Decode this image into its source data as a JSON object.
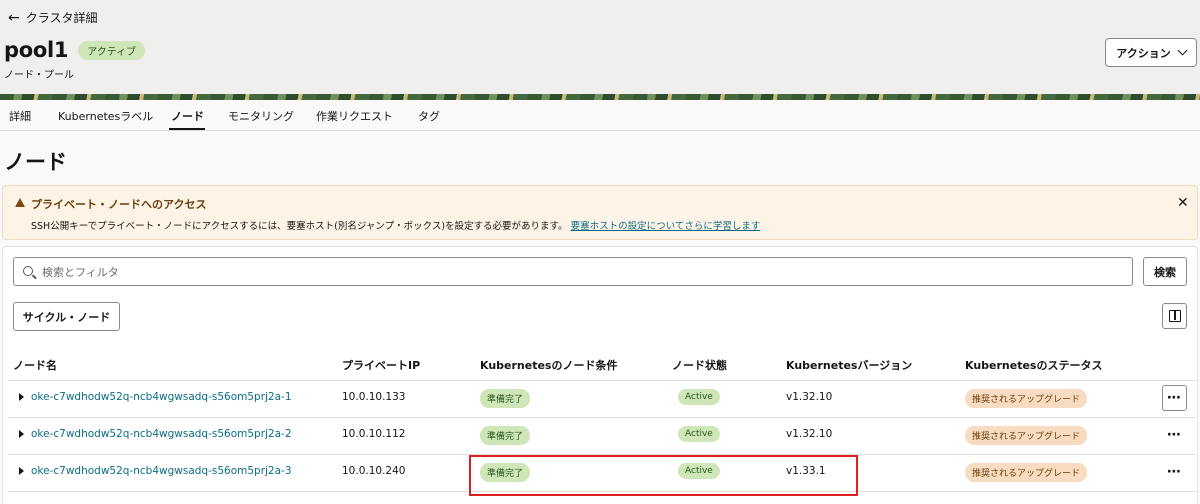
{
  "header": {
    "back_label": "クラスタ詳細",
    "title": "pool1",
    "status": "アクティブ",
    "subtitle": "ノード・プール",
    "action_label": "アクション"
  },
  "tabs": [
    "詳細",
    "Kubernetesラベル",
    "ノード",
    "モニタリング",
    "作業リクエスト",
    "タグ"
  ],
  "active_tab": "ノード",
  "section_title": "ノード",
  "notice": {
    "title": "プライベート・ノードへのアクセス",
    "body": "SSH公開キーでプライベート・ノードにアクセスするには、要塞ホスト(別名ジャンプ・ボックス)を設定する必要があります。",
    "link": "要塞ホストの設定についてさらに学習します",
    "close": "✕"
  },
  "search": {
    "placeholder": "検索とフィルタ",
    "button": "検索"
  },
  "cycle_button": "サイクル・ノード",
  "table": {
    "columns": [
      "ノード名",
      "プライベートIP",
      "Kubernetesのノード条件",
      "ノード状態",
      "Kubernetesバージョン",
      "Kubernetesのステータス"
    ],
    "rows": [
      {
        "name": "oke-c7wdhodw52q-ncb4wgwsadq-s56om5prj2a-1",
        "ip": "10.0.10.133",
        "condition": "準備完了",
        "state": "Active",
        "version": "v1.32.10",
        "status": "推奨されるアップグレード"
      },
      {
        "name": "oke-c7wdhodw52q-ncb4wgwsadq-s56om5prj2a-2",
        "ip": "10.0.10.112",
        "condition": "準備完了",
        "state": "Active",
        "version": "v1.32.10",
        "status": "推奨されるアップグレード"
      },
      {
        "name": "oke-c7wdhodw52q-ncb4wgwsadq-s56om5prj2a-3",
        "ip": "10.0.10.240",
        "condition": "準備完了",
        "state": "Active",
        "version": "v1.33.1",
        "status": "推奨されるアップグレード"
      }
    ]
  },
  "icons": {
    "back": "arrow-left-icon",
    "search": "search-icon",
    "columns": "column-layout-icon",
    "warning": "warning-icon",
    "more": "more-actions-icon"
  },
  "colors": {
    "link": "#0b6d84",
    "success_badge": "#cfe6b8",
    "upgrade_badge": "#f8dcc1",
    "highlight": "#e0201f"
  }
}
